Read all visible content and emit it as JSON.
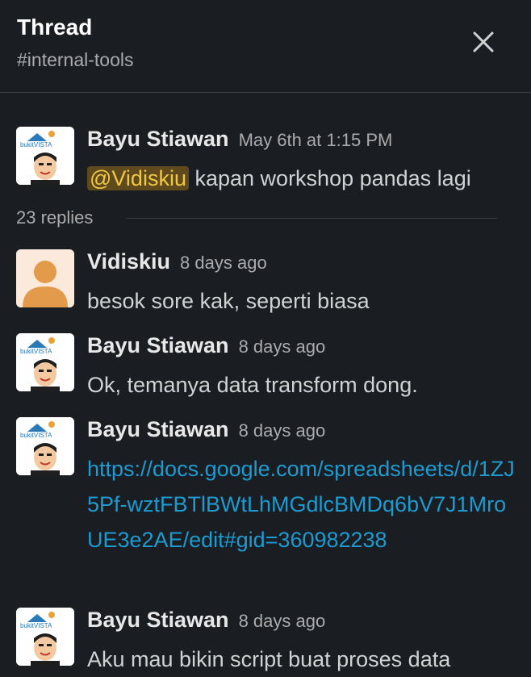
{
  "header": {
    "title": "Thread",
    "channel": "#internal-tools",
    "close_icon": "close-icon"
  },
  "parent": {
    "author": "Bayu Stiawan",
    "time": "May 6th at 1:15 PM",
    "mention": "@Vidiskiu",
    "text": "kapan workshop pandas lagi",
    "avatar_text": "bukitVISTA"
  },
  "replies": {
    "count_label": "23 replies"
  },
  "messages": [
    {
      "author": "Vidiskiu",
      "time": "8 days ago",
      "text": "besok sore kak, seperti biasa"
    },
    {
      "author": "Bayu Stiawan",
      "time": "8 days ago",
      "text": "Ok, temanya data transform dong."
    },
    {
      "author": "Bayu Stiawan",
      "time": "8 days ago",
      "link": "https://docs.google.com/spreadsheets/d/1ZJ5Pf-wztFBTlBWtLhMGdlcBMDq6bV7J1MroUE3e2AE/edit#gid=360982238"
    },
    {
      "author": "Bayu Stiawan",
      "time": "8 days ago",
      "text": "Aku mau bikin script buat proses data"
    }
  ],
  "colors": {
    "background": "#1a1d21",
    "link": "#1d9bd1",
    "mention_bg": "#5e4a1c",
    "mention_text": "#f2c744"
  }
}
